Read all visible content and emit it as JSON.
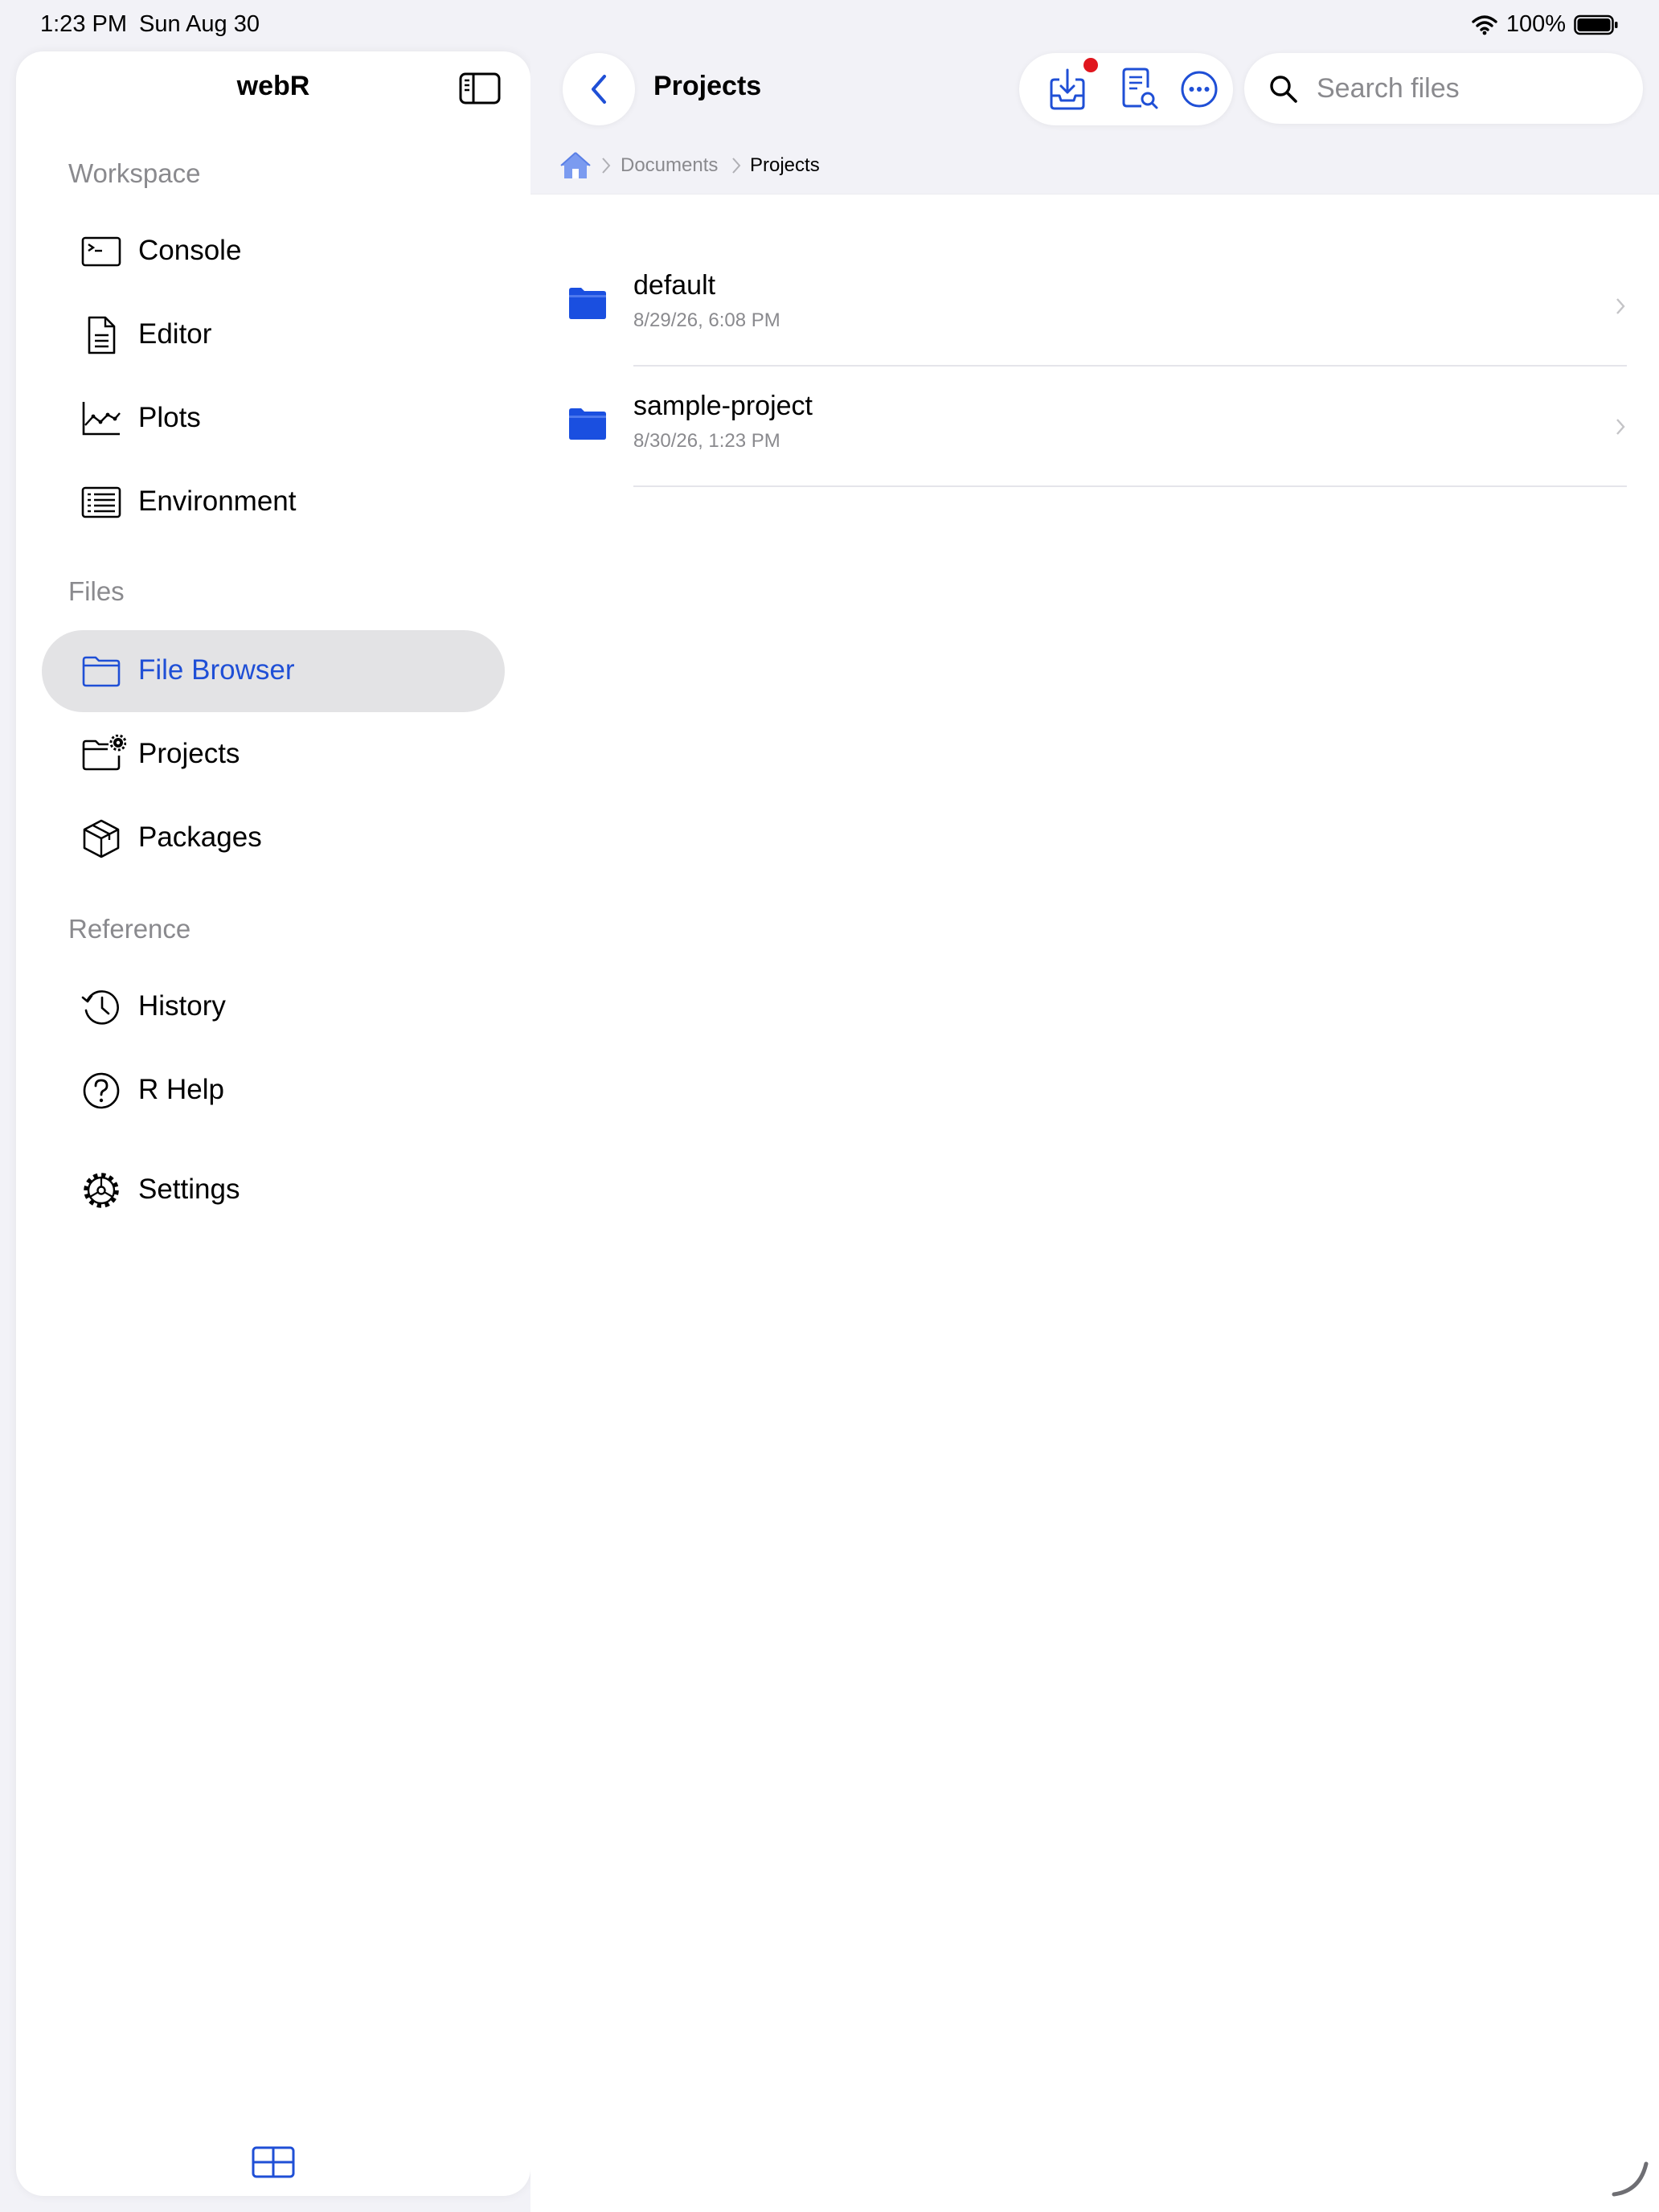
{
  "status_bar": {
    "time": "1:23 PM",
    "date": "Sun Aug 30",
    "battery": "100%"
  },
  "sidebar": {
    "title": "webR",
    "sections": [
      {
        "header": "Workspace",
        "items": [
          {
            "label": "Console",
            "icon": "terminal-icon"
          },
          {
            "label": "Editor",
            "icon": "document-icon"
          },
          {
            "label": "Plots",
            "icon": "line-chart-icon"
          },
          {
            "label": "Environment",
            "icon": "list-icon"
          }
        ]
      },
      {
        "header": "Files",
        "items": [
          {
            "label": "File Browser",
            "icon": "folder-icon",
            "selected": true
          },
          {
            "label": "Projects",
            "icon": "folder-gear-icon"
          },
          {
            "label": "Packages",
            "icon": "package-icon"
          }
        ]
      },
      {
        "header": "Reference",
        "items": [
          {
            "label": "History",
            "icon": "history-icon"
          },
          {
            "label": "R Help",
            "icon": "help-icon"
          }
        ]
      }
    ],
    "settings": {
      "label": "Settings",
      "icon": "gear-icon"
    }
  },
  "main": {
    "title": "Projects",
    "search": {
      "placeholder": "Search files",
      "value": ""
    },
    "breadcrumb": [
      "Documents",
      "Projects"
    ],
    "files": [
      {
        "name": "default",
        "date": "8/29/26, 6:08 PM",
        "type": "folder"
      },
      {
        "name": "sample-project",
        "date": "8/30/26, 1:23 PM",
        "type": "folder"
      }
    ]
  },
  "colors": {
    "accent": "#1f4fd6",
    "folder": "#1a4fe0",
    "badge": "#e0161e",
    "selected_bg": "#e3e3e5"
  }
}
